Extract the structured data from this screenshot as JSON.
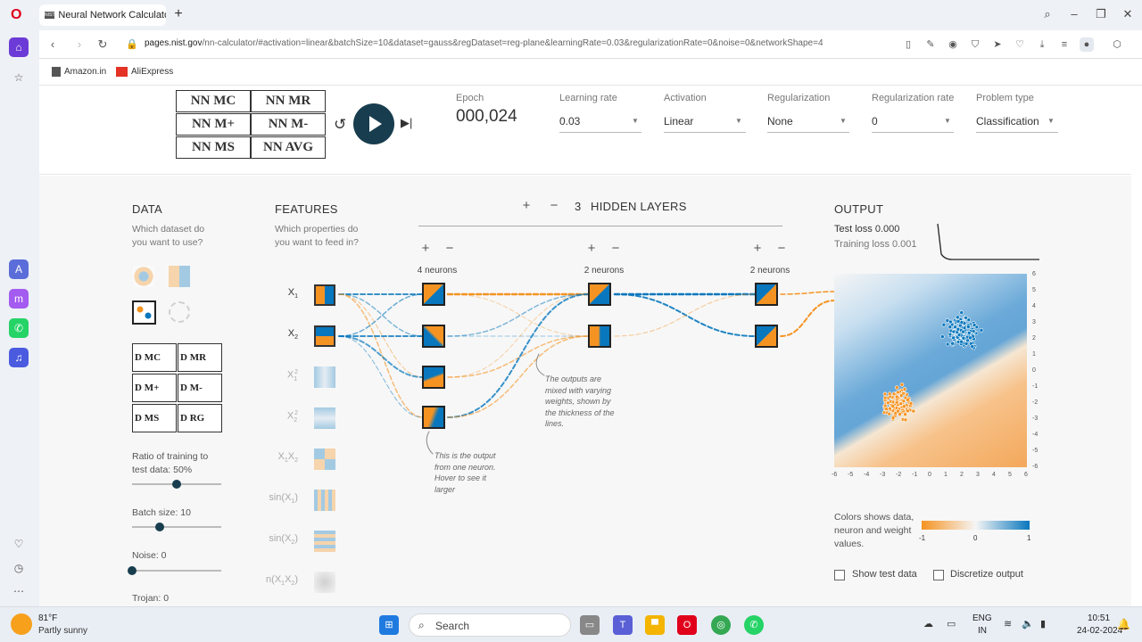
{
  "browser": {
    "tab_title": "Neural Network Calculator",
    "url_host": "pages.nist.gov",
    "url_path": "/nn-calculator/#activation=linear&batchSize=10&dataset=gauss&regDataset=reg-plane&learningRate=0.03&regularizationRate=0&noise=0&networkShape=4",
    "bookmarks": [
      "Amazon.in",
      "AliExpress"
    ]
  },
  "top": {
    "nn_buttons": [
      "NN MC",
      "NN MR",
      "NN M+",
      "NN M-",
      "NN MS",
      "NN AVG"
    ],
    "epoch_label": "Epoch",
    "epoch_value": "000,024",
    "learning_rate_label": "Learning rate",
    "learning_rate": "0.03",
    "activation_label": "Activation",
    "activation": "Linear",
    "regularization_label": "Regularization",
    "regularization": "None",
    "regularization_rate_label": "Regularization rate",
    "regularization_rate": "0",
    "problem_type_label": "Problem type",
    "problem_type": "Classification"
  },
  "data": {
    "heading": "DATA",
    "question": "Which dataset do you want to use?",
    "d_buttons": [
      "D MC",
      "D MR",
      "D M+",
      "D M-",
      "D MS",
      "D RG"
    ],
    "ratio_label": "Ratio of training to test data:  50%",
    "ratio": 0.5,
    "batch_label": "Batch size:  10",
    "batch": 0.31,
    "noise_label": "Noise:  0",
    "noise": 0,
    "trojan_label": "Trojan:  0"
  },
  "features": {
    "heading": "FEATURES",
    "question": "Which properties do you want to feed in?",
    "items": [
      {
        "main": "X",
        "sub": "1",
        "sup": "",
        "active": true
      },
      {
        "main": "X",
        "sub": "2",
        "sup": "",
        "active": true
      },
      {
        "main": "X",
        "sub": "1",
        "sup": "2",
        "active": false
      },
      {
        "main": "X",
        "sub": "2",
        "sup": "2",
        "active": false
      },
      {
        "main": "X",
        "sub": "1",
        "sup": "",
        "main2": "X",
        "sub2": "2",
        "active": false
      },
      {
        "main": "sin(X",
        "sub": "1",
        "tail": ")",
        "active": false
      },
      {
        "main": "sin(X",
        "sub": "2",
        "tail": ")",
        "active": false
      },
      {
        "main": "n(X",
        "sub": "1",
        "main2": "X",
        "sub2": "2",
        "tail": ")",
        "active": false
      }
    ]
  },
  "network": {
    "layers_count": "3",
    "layers_label": "HIDDEN LAYERS",
    "layer_neurons": [
      "4 neurons",
      "2 neurons",
      "2 neurons"
    ],
    "note1": "This is the output from one neuron. Hover to see it larger",
    "note2": "The outputs are mixed with varying weights, shown by the thickness of the lines."
  },
  "output": {
    "heading": "OUTPUT",
    "test_loss": "Test loss 0.000",
    "training_loss": "Training loss 0.001",
    "y_ticks": [
      "6",
      "5",
      "4",
      "3",
      "2",
      "1",
      "0",
      "-1",
      "-2",
      "-3",
      "-4",
      "-5",
      "-6"
    ],
    "x_ticks": [
      "-6",
      "-5",
      "-4",
      "-3",
      "-2",
      "-1",
      "0",
      "1",
      "2",
      "3",
      "4",
      "5",
      "6"
    ],
    "legend_text": "Colors shows data, neuron and weight values.",
    "scale": [
      "-1",
      "0",
      "1"
    ],
    "show_test": "Show test data",
    "discretize": "Discretize output",
    "colors": {
      "orange": "#f59322",
      "blue": "#0877bd"
    }
  },
  "taskbar": {
    "temp": "81°F",
    "weather": "Partly sunny",
    "search": "Search",
    "lang1": "ENG",
    "lang2": "IN",
    "time": "10:51",
    "date": "24-02-2024"
  }
}
